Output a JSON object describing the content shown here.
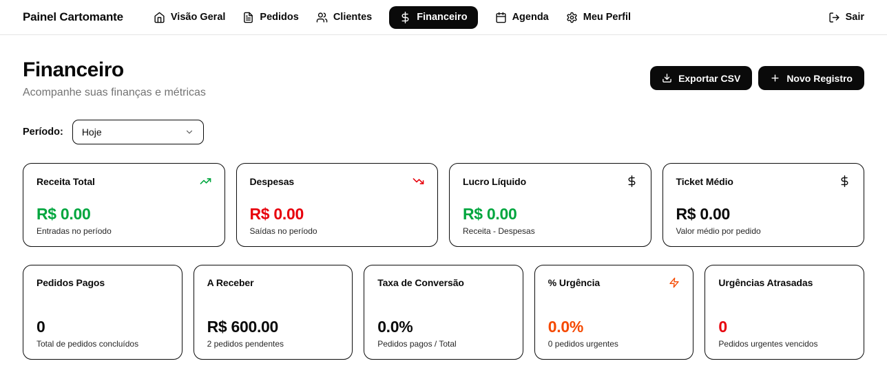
{
  "nav": {
    "brand": "Painel Cartomante",
    "items": [
      {
        "label": "Visão Geral",
        "icon": "home-icon",
        "active": false
      },
      {
        "label": "Pedidos",
        "icon": "file-text-icon",
        "active": false
      },
      {
        "label": "Clientes",
        "icon": "users-icon",
        "active": false
      },
      {
        "label": "Financeiro",
        "icon": "dollar-icon",
        "active": true
      },
      {
        "label": "Agenda",
        "icon": "calendar-icon",
        "active": false
      },
      {
        "label": "Meu Perfil",
        "icon": "gear-icon",
        "active": false
      }
    ],
    "logout_label": "Sair"
  },
  "header": {
    "title": "Financeiro",
    "subtitle": "Acompanhe suas finanças e métricas",
    "export_button": "Exportar CSV",
    "new_record_button": "Novo Registro"
  },
  "filter": {
    "label": "Período:",
    "selected": "Hoje"
  },
  "metrics_row1": [
    {
      "title": "Receita Total",
      "icon": "trending-up-icon",
      "value": "R$ 0.00",
      "sublabel": "Entradas no período",
      "color": "#00a63e"
    },
    {
      "title": "Despesas",
      "icon": "trending-down-icon",
      "value": "R$ 0.00",
      "sublabel": "Saídas no período",
      "color": "#e7000b"
    },
    {
      "title": "Lucro Líquido",
      "icon": "dollar-icon",
      "value": "R$ 0.00",
      "sublabel": "Receita - Despesas",
      "color": "#00a63e"
    },
    {
      "title": "Ticket Médio",
      "icon": "dollar-icon",
      "value": "R$ 0.00",
      "sublabel": "Valor médio por pedido",
      "color": "#0a0a0a"
    }
  ],
  "metrics_row2": [
    {
      "title": "Pedidos Pagos",
      "icon": null,
      "value": "0",
      "sublabel": "Total de pedidos concluídos",
      "color": "#0a0a0a"
    },
    {
      "title": "A Receber",
      "icon": null,
      "value": "R$ 600.00",
      "sublabel": "2 pedidos pendentes",
      "color": "#0a0a0a"
    },
    {
      "title": "Taxa de Conversão",
      "icon": null,
      "value": "0.0%",
      "sublabel": "Pedidos pagos / Total",
      "color": "#0a0a0a"
    },
    {
      "title": "% Urgência",
      "icon": "zap-icon",
      "value": "0.0%",
      "sublabel": "0 pedidos urgentes",
      "color": "#f54900"
    },
    {
      "title": "Urgências Atrasadas",
      "icon": null,
      "value": "0",
      "sublabel": "Pedidos urgentes vencidos",
      "color": "#e7000b"
    }
  ],
  "colors": {
    "green": "#00a63e",
    "red": "#e7000b",
    "orange": "#f54900",
    "ink": "#0a0a0a",
    "subtitle_gray": "#737373",
    "divider": "#e5e5e5"
  }
}
